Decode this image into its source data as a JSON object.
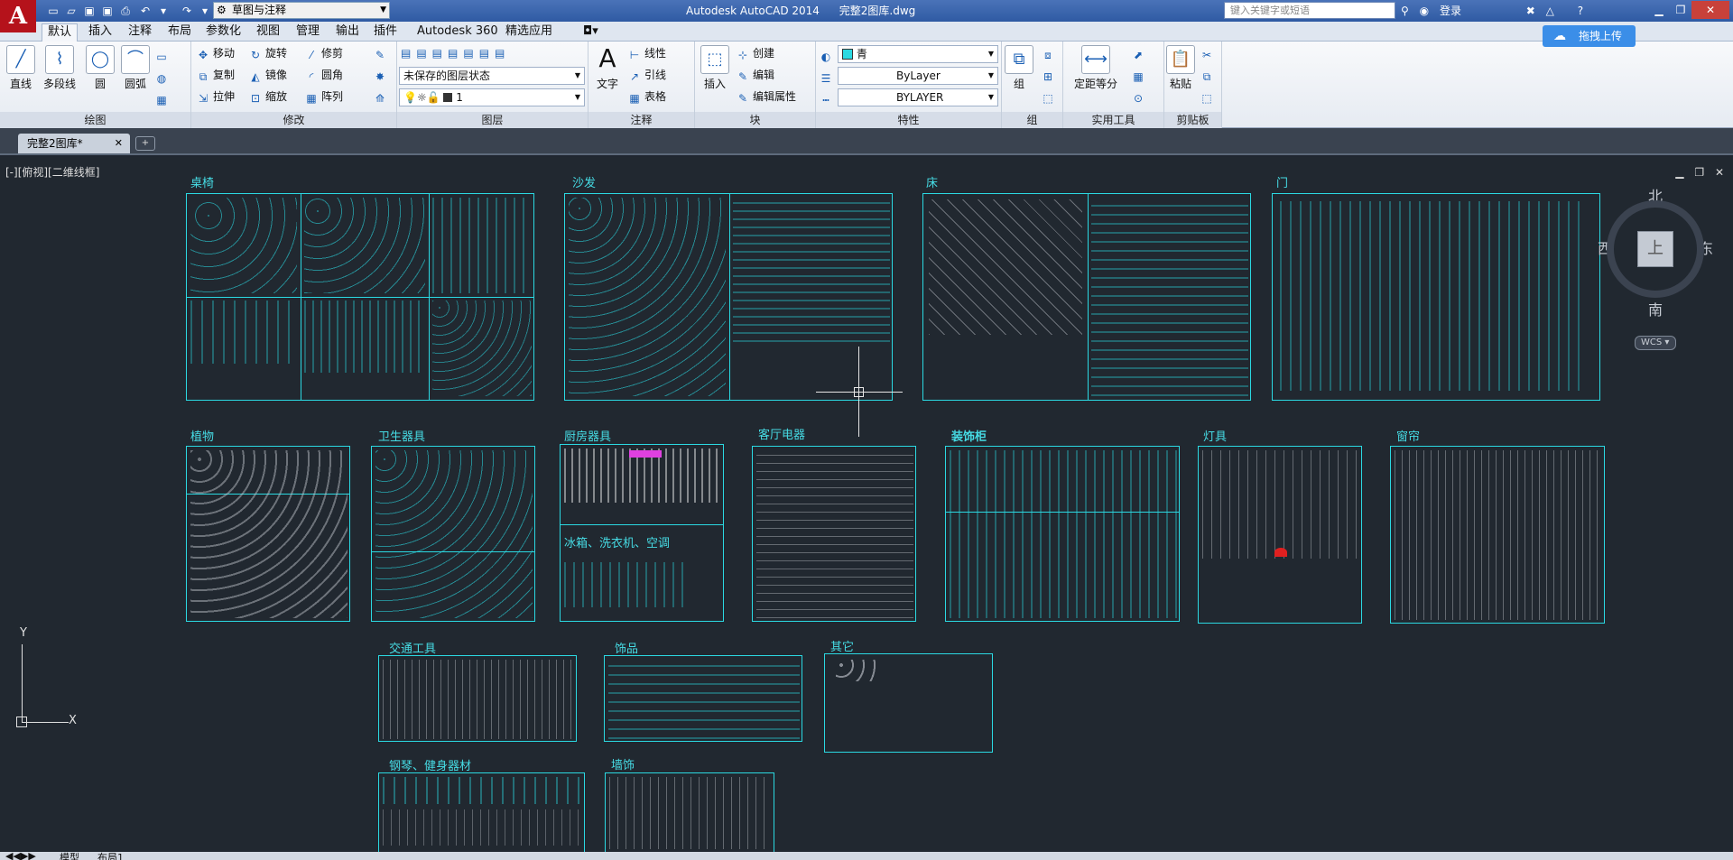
{
  "app": {
    "title": "Autodesk AutoCAD 2014",
    "document": "完整2图库.dwg",
    "logo_letter": "A",
    "workspace": "草图与注释",
    "search_placeholder": "键入关键字或短语",
    "login": "登录",
    "help": "?"
  },
  "ribbon_tabs": [
    "默认",
    "插入",
    "注释",
    "布局",
    "参数化",
    "视图",
    "管理",
    "输出",
    "插件",
    "Autodesk 360",
    "精选应用"
  ],
  "upload_button": "拖拽上传",
  "panels": {
    "draw": {
      "title": "绘图",
      "buttons": [
        "直线",
        "多段线",
        "圆",
        "圆弧"
      ]
    },
    "modify": {
      "title": "修改",
      "buttons": [
        "移动",
        "旋转",
        "修剪",
        "复制",
        "镜像",
        "圆角",
        "拉伸",
        "缩放",
        "阵列"
      ]
    },
    "layers": {
      "title": "图层",
      "layer_state": "未保存的图层状态",
      "current_layer": "1"
    },
    "annotation": {
      "title": "注释",
      "text": "文字",
      "buttons": [
        "线性",
        "引线",
        "表格"
      ]
    },
    "block": {
      "title": "块",
      "insert": "插入",
      "buttons": [
        "创建",
        "编辑",
        "编辑属性"
      ]
    },
    "properties": {
      "title": "特性",
      "color": "青",
      "linetype": "ByLayer",
      "lineweight": "BYLAYER"
    },
    "group": {
      "title": "组",
      "button": "组"
    },
    "utilities": {
      "title": "实用工具",
      "button": "定距等分"
    },
    "clipboard": {
      "title": "剪贴板",
      "button": "粘贴"
    }
  },
  "doc_tab": "完整2图库*",
  "view_label": "[-][俯视][二维线框]",
  "viewcube": {
    "north": "北",
    "south": "南",
    "east": "东",
    "west": "西",
    "face": "上",
    "wcs": "WCS"
  },
  "blocks": {
    "tables_chairs": "桌椅",
    "sofa": "沙发",
    "bed": "床",
    "door": "门",
    "plants": "植物",
    "sanitary": "卫生器具",
    "kitchen": "厨房器具",
    "appliances_sub": "冰箱、洗衣机、空调",
    "living_appliances": "客厅电器",
    "cabinet": "装饰柜",
    "lamps": "灯具",
    "curtains": "窗帘",
    "transport": "交通工具",
    "ornaments": "饰品",
    "other": "其它",
    "piano_fitness": "钢琴、健身器材",
    "wall_decor": "墙饰"
  },
  "ucs": {
    "x": "X",
    "y": "Y"
  },
  "layout_tabs": [
    "模型",
    "布局1"
  ],
  "colors": {
    "cyan": "#2bd9e2",
    "canvas": "#212830",
    "accent": "#3b8ee8"
  }
}
